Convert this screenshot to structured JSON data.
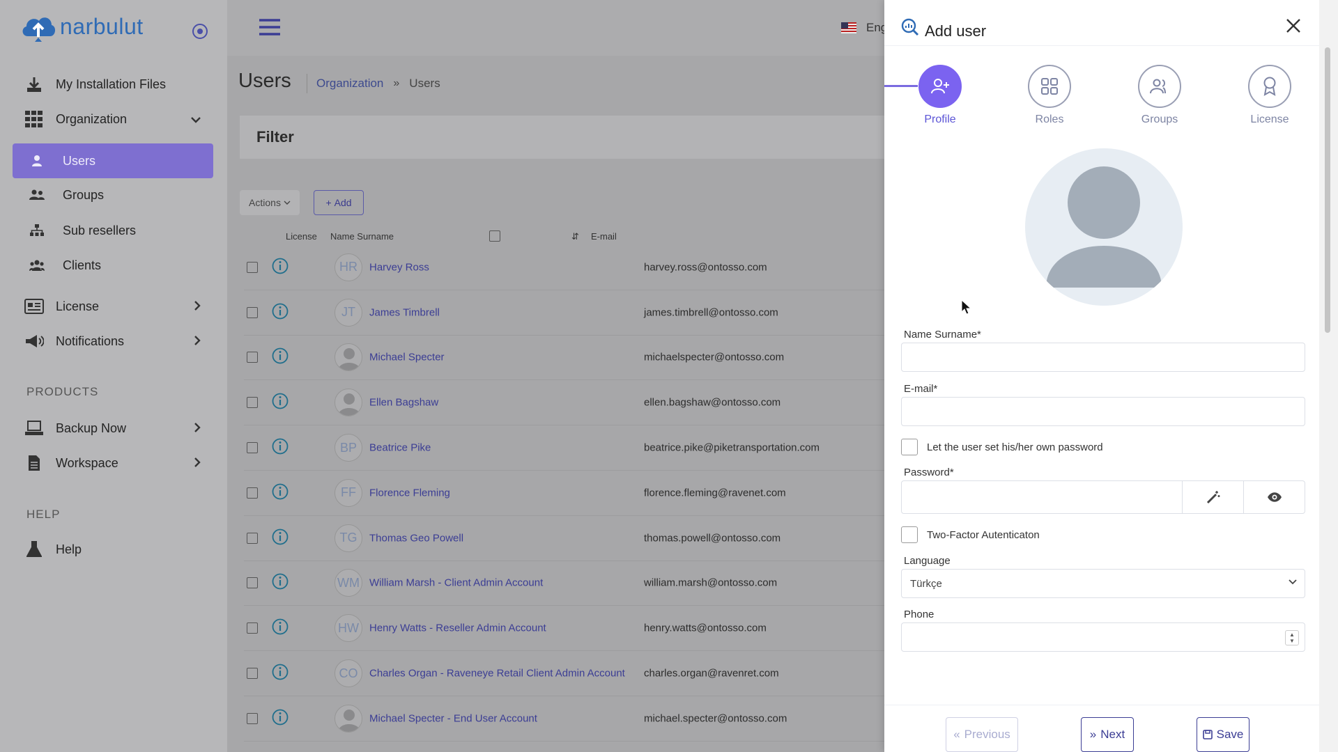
{
  "app": {
    "logo_text": "narbulut",
    "language": "Eng"
  },
  "sidebar": {
    "items": [
      {
        "label": "My Installation Files",
        "icon": "download-icon"
      },
      {
        "label": "Organization",
        "icon": "grid-icon"
      },
      {
        "label": "Users",
        "icon": "user-icon"
      },
      {
        "label": "Groups",
        "icon": "users-icon"
      },
      {
        "label": "Sub resellers",
        "icon": "sitemap-icon"
      },
      {
        "label": "Clients",
        "icon": "clients-icon"
      },
      {
        "label": "License",
        "icon": "id-card-icon"
      },
      {
        "label": "Notifications",
        "icon": "megaphone-icon"
      },
      {
        "label": "Backup Now",
        "icon": "server-icon"
      },
      {
        "label": "Workspace",
        "icon": "document-icon"
      },
      {
        "label": "Help",
        "icon": "flask-icon"
      }
    ],
    "section_products": "PRODUCTS",
    "section_help": "HELP"
  },
  "page": {
    "title": "Users",
    "breadcrumb": [
      "Organization",
      "Users"
    ],
    "filter_title": "Filter",
    "actions_label": "Actions",
    "add_label": "Add",
    "columns": [
      "License",
      "Name Surname",
      "E-mail"
    ],
    "rows": [
      {
        "initials": "HR",
        "name": "Harvey Ross",
        "email": "harvey.ross@ontosso.com"
      },
      {
        "initials": "JT",
        "name": "James Timbrell",
        "email": "james.timbrell@ontosso.com"
      },
      {
        "initials": "",
        "name": "Michael Specter",
        "email": "michaelspecter@ontosso.com"
      },
      {
        "initials": "",
        "name": "Ellen Bagshaw",
        "email": "ellen.bagshaw@ontosso.com"
      },
      {
        "initials": "BP",
        "name": "Beatrice Pike",
        "email": "beatrice.pike@piketransportation.com"
      },
      {
        "initials": "FF",
        "name": "Florence Fleming",
        "email": "florence.fleming@ravenet.com"
      },
      {
        "initials": "TG",
        "name": "Thomas Geo Powell",
        "email": "thomas.powell@ontosso.com"
      },
      {
        "initials": "WM",
        "name": "William Marsh - Client Admin Account",
        "email": "william.marsh@ontosso.com"
      },
      {
        "initials": "HW",
        "name": "Henry Watts - Reseller Admin Account",
        "email": "henry.watts@ontosso.com"
      },
      {
        "initials": "CO",
        "name": "Charles Organ - Raveneye Retail Client Admin Account",
        "email": "charles.organ@ravenret.com"
      },
      {
        "initials": "",
        "name": "Michael Specter - End User Account",
        "email": "michael.specter@ontosso.com"
      }
    ]
  },
  "drawer": {
    "title": "Add user",
    "steps": [
      "Profile",
      "Roles",
      "Groups",
      "License"
    ],
    "name_label": "Name Surname*",
    "name_value": "",
    "email_label": "E-mail*",
    "email_value": "",
    "own_password_label": "Let the user set his/her own password",
    "password_label": "Password*",
    "two_factor_label": "Two-Factor Autenticaton",
    "language_label": "Language",
    "language_value": "Türkçe",
    "phone_label": "Phone",
    "previous_label": "Previous",
    "next_label": "Next",
    "save_label": "Save"
  },
  "colors": {
    "accent": "#7b63f0",
    "link": "#3b3d94",
    "overlay": "#a9a9ab"
  }
}
